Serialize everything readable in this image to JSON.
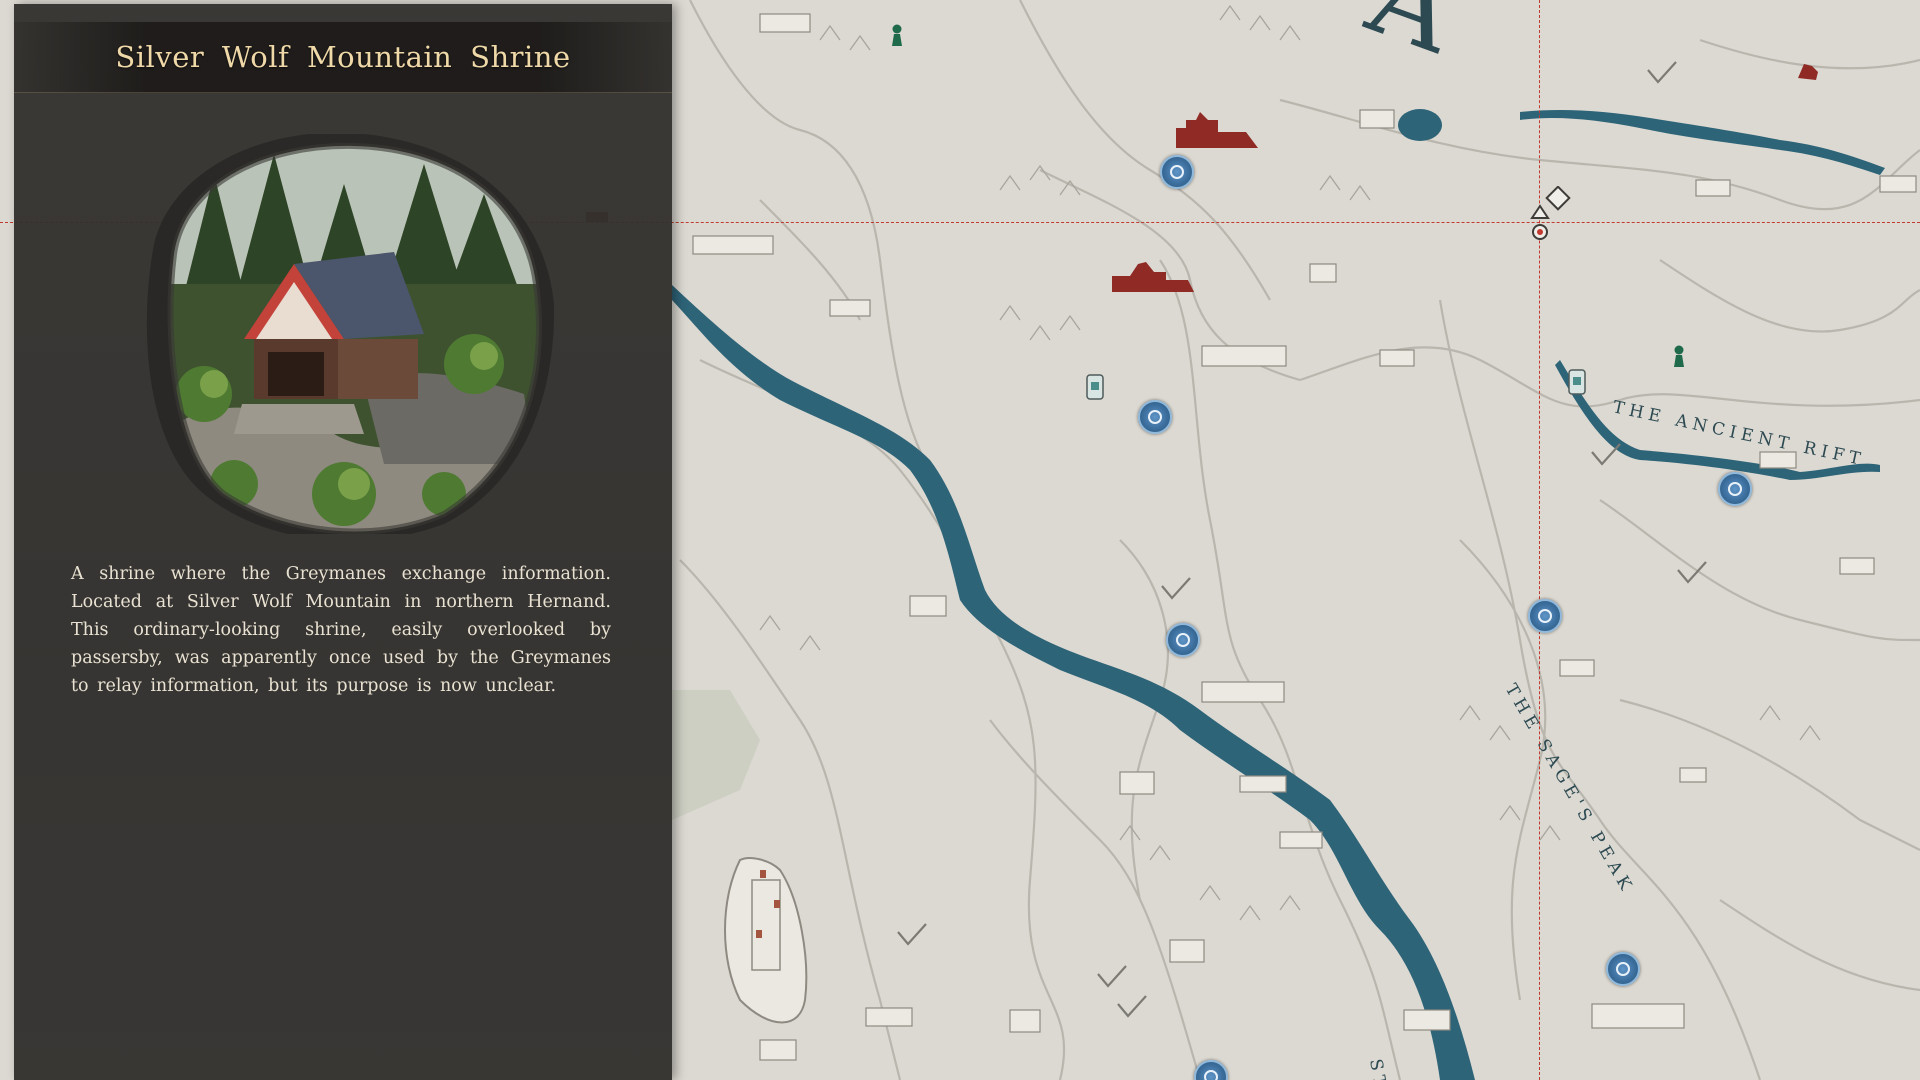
{
  "panel": {
    "title": "Silver Wolf Mountain Shrine",
    "description": "A shrine where the Greymanes exchange information. Located at Silver Wolf Mountain in northern Hernand. This ordinary-looking shrine, easily overlooked by passersby, was apparently once used by the Greymanes to relay information, but its purpose is now unclear."
  },
  "map": {
    "region_labels": {
      "ancient_rift": "THE ANCIENT RIFT",
      "sages_peak": "THE SAGE'S PEAK",
      "bottom_partial": "STO",
      "top_glyph": "A"
    },
    "icons": {
      "waypoint": "fast-travel-icon",
      "pawn": "pawn-icon",
      "stele": "stele-icon",
      "camp": "campsite-icon",
      "fort": "fortress-icon",
      "selected": "location-pin-icon"
    }
  },
  "colors": {
    "map_bg": "#dcd9d2",
    "river": "#2e6478",
    "crosshair": "#c23a2f",
    "title": "#f0d9a8",
    "fort_red": "#8f2a24",
    "pawn_green": "#1f6a4a",
    "waypoint_blue": "#3c6f9e"
  }
}
